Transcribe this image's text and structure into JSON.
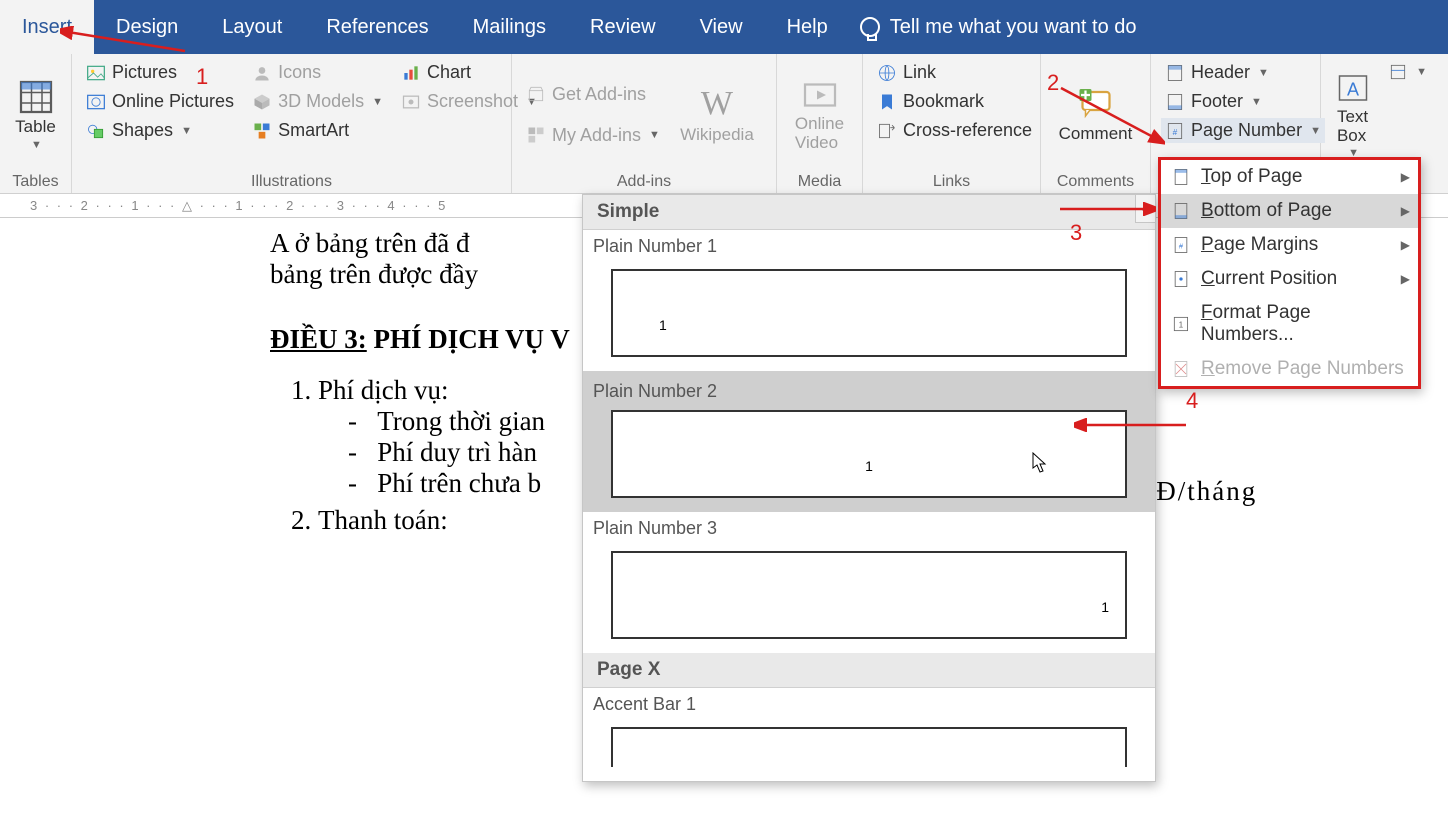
{
  "tabs": {
    "insert": "Insert",
    "design": "Design",
    "layout": "Layout",
    "references": "References",
    "mailings": "Mailings",
    "review": "Review",
    "view": "View",
    "help": "Help",
    "tellme": "Tell me what you want to do"
  },
  "groups": {
    "tables": {
      "table": "Table",
      "label": "Tables"
    },
    "illustrations": {
      "pictures": "Pictures",
      "online_pictures": "Online Pictures",
      "shapes": "Shapes",
      "icons": "Icons",
      "models3d": "3D Models",
      "smartart": "SmartArt",
      "chart": "Chart",
      "screenshot": "Screenshot",
      "label": "Illustrations"
    },
    "addins": {
      "get": "Get Add-ins",
      "my": "My Add-ins",
      "wikipedia": "Wikipedia",
      "label": "Add-ins"
    },
    "media": {
      "online_video": "Online\nVideo",
      "label": "Media"
    },
    "links": {
      "link": "Link",
      "bookmark": "Bookmark",
      "crossref": "Cross-reference",
      "label": "Links"
    },
    "comments": {
      "comment": "Comment",
      "label": "Comments"
    },
    "headerfooter": {
      "header": "Header",
      "footer": "Footer",
      "pagenum": "Page Number"
    },
    "text": {
      "textbox": "Text\nBox"
    }
  },
  "submenu": {
    "top": "Top of Page",
    "bottom": "Bottom of Page",
    "margins": "Page Margins",
    "current": "Current Position",
    "format": "Format Page Numbers...",
    "remove": "Remove Page Numbers"
  },
  "gallery": {
    "header": "Simple",
    "pn1": "Plain Number 1",
    "pn2": "Plain Number 2",
    "pn3": "Plain Number 3",
    "pagex": "Page X",
    "accent1": "Accent Bar 1"
  },
  "doc": {
    "line1": "A ở bảng trên đã đ",
    "line2": "bảng trên được đầy",
    "h3a": "ĐIỀU 3:",
    "h3b": " PHÍ DỊCH VỤ V",
    "ol1": "Phí dịch vụ:",
    "d1": "Trong thời gian",
    "d2": "Phí duy trì hàn",
    "d3": "Phí trên chưa b",
    "ol2": "Thanh toán:",
    "right_dots": "…………… VNĐ/tháng"
  },
  "anno": {
    "n1": "1",
    "n2": "2",
    "n3": "3",
    "n4": "4"
  }
}
